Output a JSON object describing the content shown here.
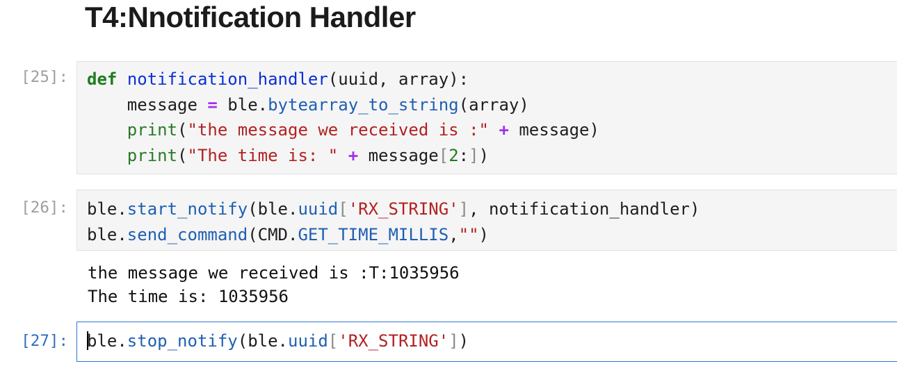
{
  "heading": "T4:Nnotification Handler",
  "cells": [
    {
      "prompt": "[25]:",
      "lines": [
        [
          "def",
          " ",
          "notification_handler",
          "(uuid, array):"
        ],
        [
          "    message ",
          "=",
          " ble.",
          "bytearray_to_string",
          "(array)"
        ],
        [
          "    ",
          "print",
          "(",
          "\"the message we received is :\"",
          " ",
          "+",
          " message)"
        ],
        [
          "    ",
          "print",
          "(",
          "\"The time is: \"",
          " ",
          "+",
          " message",
          "[",
          "2",
          ":",
          "]",
          ")"
        ]
      ]
    },
    {
      "prompt": "[26]:",
      "lines": [
        [
          "ble.",
          "start_notify",
          "(ble.",
          "uuid",
          "[",
          "'RX_STRING'",
          "]",
          ", notification_handler)"
        ],
        [
          "ble.",
          "send_command",
          "(CMD.",
          "GET_TIME_MILLIS",
          ",",
          "\"\"",
          ")"
        ]
      ],
      "output": [
        "the message we received is :T:1035956",
        "The time is: 1035956"
      ]
    },
    {
      "prompt": "[27]:",
      "lines": [
        [
          "ble.",
          "stop_notify",
          "(ble.",
          "uuid",
          "[",
          "'RX_STRING'",
          "]",
          ")"
        ]
      ]
    }
  ]
}
